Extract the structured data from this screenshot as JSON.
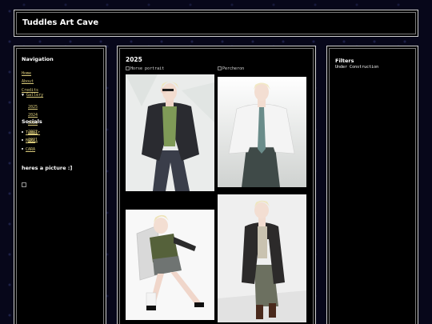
{
  "site": {
    "title": "Tuddles Art Cave"
  },
  "navigation": {
    "title": "Navigation",
    "items": [
      "Home",
      "About",
      "Credits"
    ],
    "gallery": {
      "marker": "▼",
      "label": "Gallery",
      "years": [
        "2025",
        "2024",
        "2023",
        "2022",
        "2021"
      ]
    }
  },
  "socials": {
    "title": "Socials",
    "items": [
      "Tumblr",
      "BSKY",
      "CARA"
    ]
  },
  "picture": {
    "title": "heres a picture :]"
  },
  "main": {
    "year": "2025",
    "images": [
      {
        "alt": "Horse portrait"
      },
      {
        "alt": "Percheron"
      }
    ]
  },
  "filters": {
    "title": "Filters",
    "status": "Under Construction"
  },
  "colors": {
    "link": "#d8c97a",
    "background": "#07071a",
    "panel": "#000000",
    "border": "#cfcfcf"
  }
}
